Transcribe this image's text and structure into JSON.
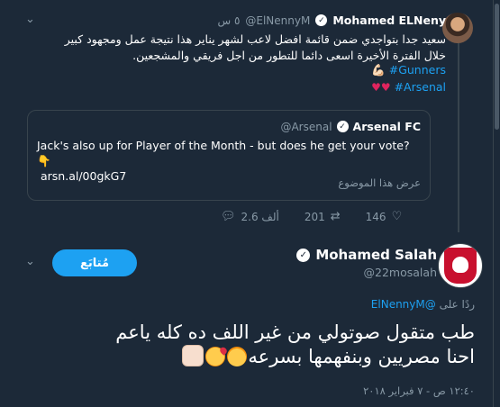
{
  "parent_tweet": {
    "display_name": "Mohamed ELNeny",
    "handle": "@ElNennyM",
    "time": "٥ س",
    "text": "سعيد جدا بتواجدي ضمن قائمة افضل لاعب لشهر يناير هذا نتيجة عمل ومجهود كبير خلال الفترة الأخيرة اسعى دائما للتطور من اجل فريقي والمشجعين.",
    "flex_emoji": "💪🏻",
    "hashtag1": "#Gunners",
    "hashtag2": "#Arsenal",
    "hearts": "♥♥",
    "quote": {
      "display_name": "Arsenal FC",
      "handle": "@Arsenal",
      "text": "Jack's also up for Player of the Month - but does he get your vote? 👇",
      "link": "arsn.al/00gkG7",
      "show_topic": "عرض هذا الموضوع"
    },
    "actions": {
      "likes": "146",
      "retweets": "201",
      "replies": "2.6 ألف"
    }
  },
  "main_tweet": {
    "display_name": "Mohamed Salah",
    "handle": "@22mosalah",
    "follow_label": "مُتابَع",
    "reply_prefix": "ردًا على",
    "reply_handle": "@ElNennyM",
    "text_line1": "طب متقول صوتولي من غير اللف ده كله ياعم",
    "text_line2": "احنا مصريين وبنفهمها بسرعه",
    "timestamp": "١٢:٤٠ ص - ٧ فبراير ٢٠١٨"
  },
  "colors": {
    "background": "#1c2938",
    "accent": "#1da1f2",
    "muted": "#8899a6",
    "heart": "#e0245e"
  }
}
